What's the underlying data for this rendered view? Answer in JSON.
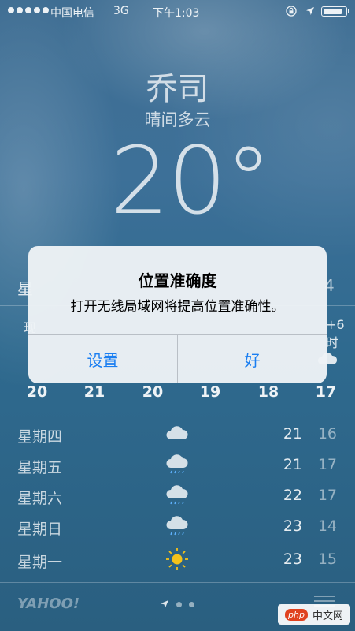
{
  "status_bar": {
    "carrier": "中国电信",
    "network": "3G",
    "time": "下午1:03",
    "signal_bars": 5,
    "battery_level": 0.88,
    "icons": [
      "rotation-lock-icon",
      "location-arrow-icon",
      "battery-icon"
    ]
  },
  "weather": {
    "city": "乔司",
    "condition": "晴间多云",
    "temperature": "20°"
  },
  "today": {
    "label_partial": "星",
    "low_partial": "4"
  },
  "hourly": {
    "first_label_partial": "现",
    "last_label_partial": "+6时",
    "temps": [
      "20",
      "21",
      "20",
      "19",
      "18",
      "17"
    ]
  },
  "daily": [
    {
      "day": "星期四",
      "icon": "cloud-icon",
      "high": "21",
      "low": "16"
    },
    {
      "day": "星期五",
      "icon": "rain-cloud-icon",
      "high": "21",
      "low": "17"
    },
    {
      "day": "星期六",
      "icon": "rain-cloud-icon",
      "high": "22",
      "low": "17"
    },
    {
      "day": "星期日",
      "icon": "rain-cloud-icon",
      "high": "23",
      "low": "14"
    },
    {
      "day": "星期一",
      "icon": "sun-icon",
      "high": "23",
      "low": "15"
    }
  ],
  "footer": {
    "yahoo": "YAHOO!",
    "watermark_badge": "php",
    "watermark_text": "中文网",
    "page_count": 3
  },
  "alert": {
    "title": "位置准确度",
    "message": "打开无线局域网将提高位置准确性。",
    "left_button": "设置",
    "right_button": "好"
  },
  "colors": {
    "accent": "#1a7ef1",
    "background_top": "#3f6e93",
    "background_bottom": "#2a5f80"
  }
}
